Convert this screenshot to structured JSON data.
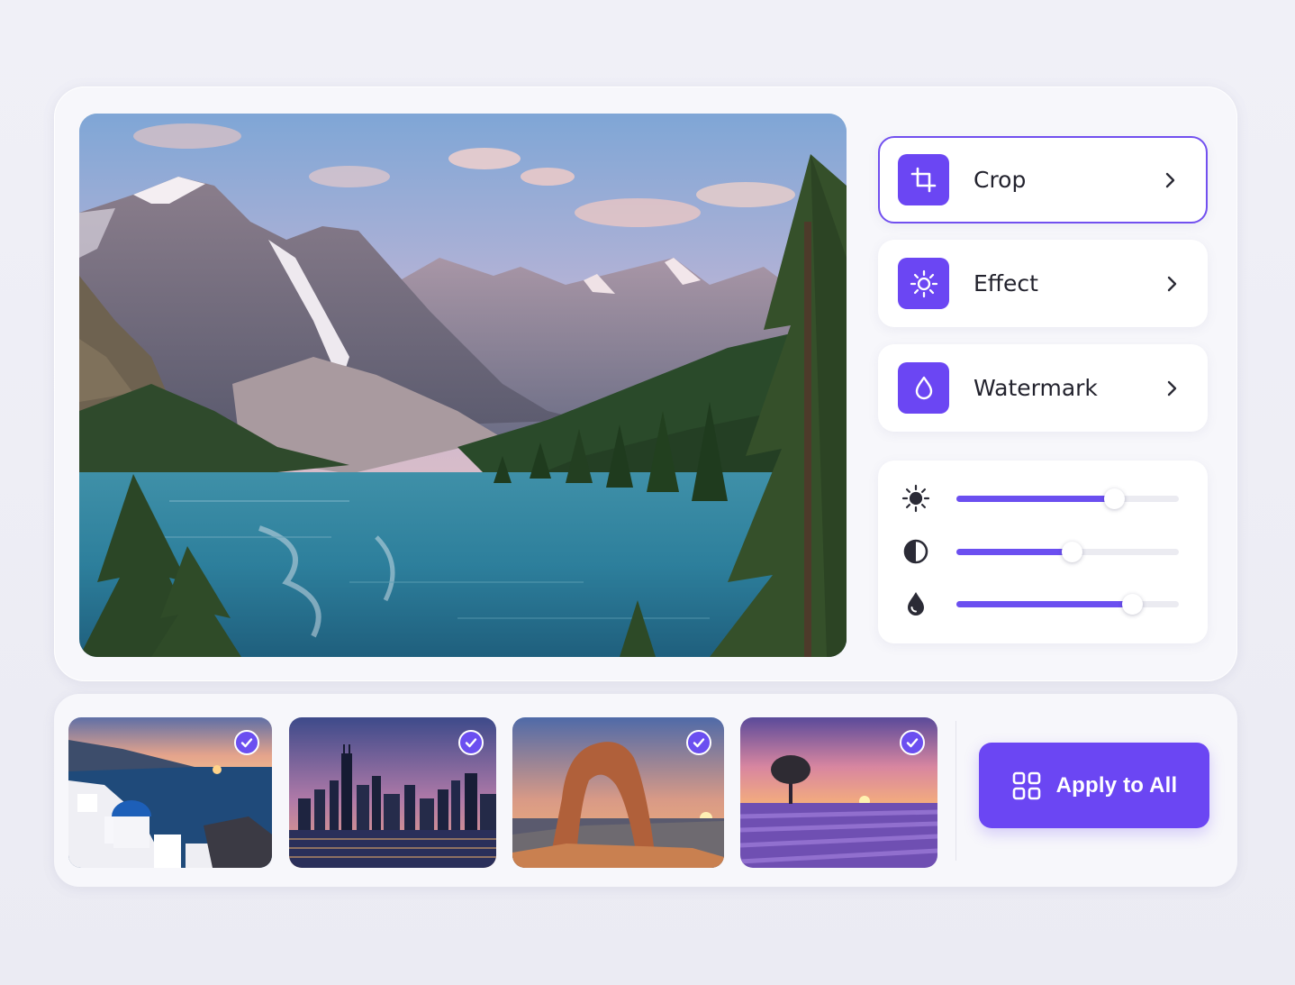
{
  "tools": [
    {
      "label": "Crop",
      "icon": "crop-icon",
      "active": true
    },
    {
      "label": "Effect",
      "icon": "sun-icon",
      "active": false
    },
    {
      "label": "Watermark",
      "icon": "droplet-icon",
      "active": false
    }
  ],
  "adjustments": [
    {
      "icon": "brightness-icon",
      "value": 0.71
    },
    {
      "icon": "contrast-icon",
      "value": 0.52
    },
    {
      "icon": "saturation-icon",
      "value": 0.79
    }
  ],
  "batch": {
    "thumbnails": [
      {
        "icon": "check-icon",
        "selected": true
      },
      {
        "icon": "check-icon",
        "selected": true
      },
      {
        "icon": "check-icon",
        "selected": true
      },
      {
        "icon": "check-icon",
        "selected": true
      }
    ],
    "apply_label": "Apply to All",
    "apply_icon": "grid-icon"
  },
  "colors": {
    "accent": "#6b46f3",
    "accent_border": "#7250ef",
    "slider_fill": "#6b4ff0",
    "background": "#efeff6"
  }
}
